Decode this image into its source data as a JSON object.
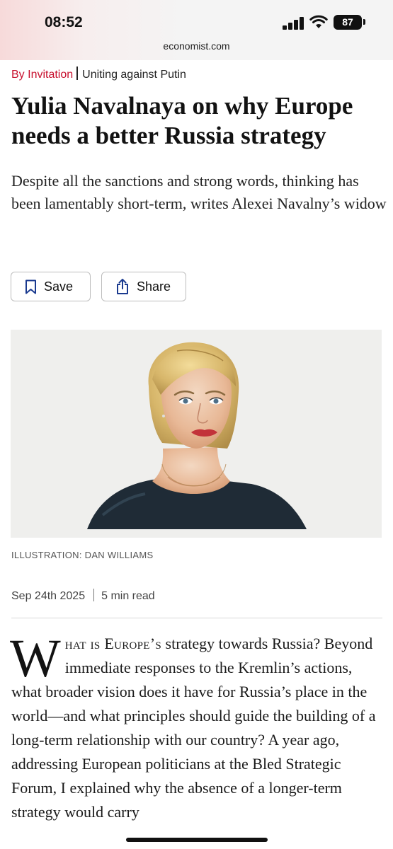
{
  "status_bar": {
    "time": "08:52",
    "battery": "87",
    "url": "economist.com"
  },
  "article": {
    "section": "By Invitation",
    "topic": "Uniting against Putin",
    "headline": "Yulia Navalnaya on why Europe needs a better Russia strategy",
    "standfirst": "Despite all the sanctions and strong words, thinking has been lamentably short-term, writes Alexei Navalny’s widow",
    "image_credit": "ILLUSTRATION: DAN WILLIAMS",
    "date": "Sep 24th 2025",
    "read_time": "5 min read",
    "drop_cap": "W",
    "body_smallcaps": "hat is Europe’s",
    "body_text": " strategy towards Russia? Beyond immediate responses to the Kremlin’s actions, what broader vision does it have for Russia’s place in the world—and what principles should guide the building of a long-term relationship with our country? A year ago, addressing European politicians at the Bled Strategic Forum, I explained why the absence of a longer-term strategy would carry"
  },
  "actions": {
    "save_label": "Save",
    "share_label": "Share"
  },
  "colors": {
    "accent_red": "#c8102e",
    "text": "#121212",
    "border": "#bdbdbd"
  },
  "icons": [
    "signal-icon",
    "wifi-icon",
    "battery-icon",
    "bookmark-icon",
    "share-icon"
  ]
}
